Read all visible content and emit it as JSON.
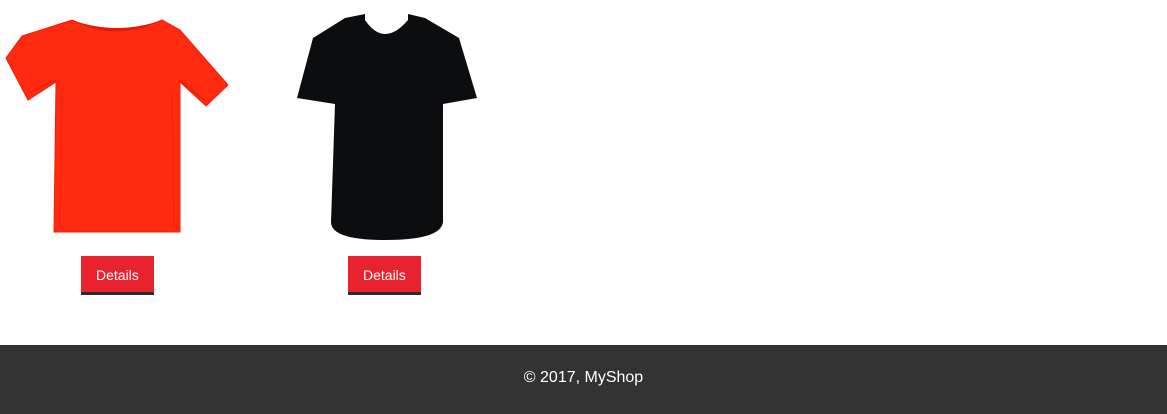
{
  "products": [
    {
      "image": "red-tshirt",
      "color": "#ff2a10",
      "details_label": "Details"
    },
    {
      "image": "black-tshirt",
      "color": "#0b0d0e",
      "details_label": "Details"
    }
  ],
  "theme": {
    "button_color": "#e8222f",
    "footer_bg": "#333333"
  },
  "footer": {
    "copyright": "© 2017, MyShop"
  }
}
